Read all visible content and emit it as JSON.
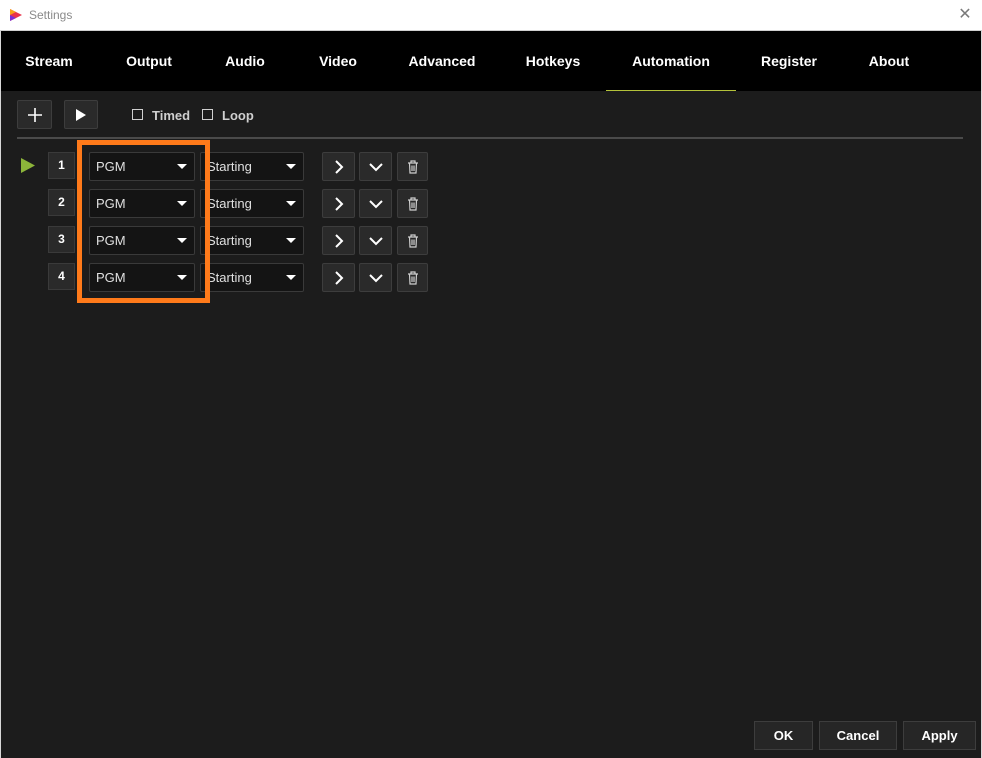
{
  "window": {
    "title": "Settings"
  },
  "tabs": [
    {
      "label": "Stream"
    },
    {
      "label": "Output"
    },
    {
      "label": "Audio"
    },
    {
      "label": "Video"
    },
    {
      "label": "Advanced"
    },
    {
      "label": "Hotkeys"
    },
    {
      "label": "Automation",
      "active": true
    },
    {
      "label": "Register"
    },
    {
      "label": "About"
    }
  ],
  "toolbar": {
    "timed_label": "Timed",
    "loop_label": "Loop"
  },
  "rows": [
    {
      "number": "1",
      "source": "PGM",
      "action": "Starting"
    },
    {
      "number": "2",
      "source": "PGM",
      "action": "Starting"
    },
    {
      "number": "3",
      "source": "PGM",
      "action": "Starting"
    },
    {
      "number": "4",
      "source": "PGM",
      "action": "Starting"
    }
  ],
  "footer": {
    "ok_label": "OK",
    "cancel_label": "Cancel",
    "apply_label": "Apply"
  },
  "colors": {
    "accent": "#b4c23a",
    "highlight": "#ff7a1a",
    "play": "#8cb43a"
  }
}
